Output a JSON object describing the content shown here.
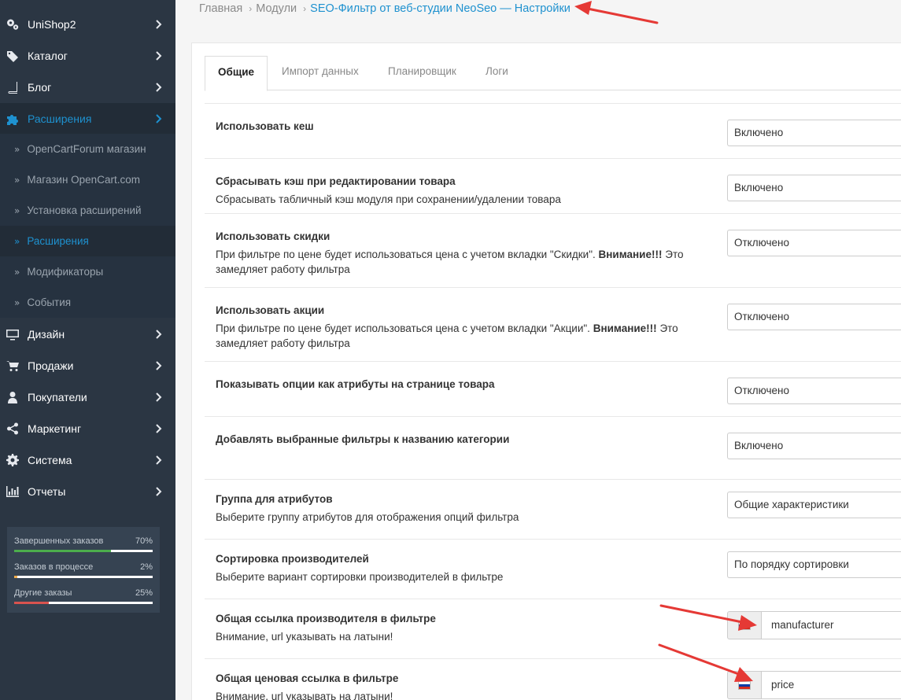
{
  "sidebar": {
    "items": [
      {
        "label": "UniShop2",
        "icon": "gears-icon"
      },
      {
        "label": "Каталог",
        "icon": "tags-icon"
      },
      {
        "label": "Блог",
        "icon": "book-icon"
      },
      {
        "label": "Расширения",
        "icon": "puzzle-icon"
      },
      {
        "label": "Дизайн",
        "icon": "monitor-icon"
      },
      {
        "label": "Продажи",
        "icon": "cart-icon"
      },
      {
        "label": "Покупатели",
        "icon": "user-icon"
      },
      {
        "label": "Маркетинг",
        "icon": "share-icon"
      },
      {
        "label": "Система",
        "icon": "cog-icon"
      },
      {
        "label": "Отчеты",
        "icon": "bar-chart-icon"
      }
    ],
    "subitems": [
      {
        "label": "OpenCartForum магазин"
      },
      {
        "label": "Магазин OpenCart.com"
      },
      {
        "label": "Установка расширений"
      },
      {
        "label": "Расширения"
      },
      {
        "label": "Модификаторы"
      },
      {
        "label": "События"
      }
    ],
    "stats": [
      {
        "label": "Завершенных заказов",
        "percent": "70%",
        "value": 0.7,
        "color": "#4cae4c"
      },
      {
        "label": "Заказов в процессе",
        "percent": "2%",
        "value": 0.02,
        "color": "#f0ad4e"
      },
      {
        "label": "Другие заказы",
        "percent": "25%",
        "value": 0.25,
        "color": "#d9534f"
      }
    ]
  },
  "breadcrumb": {
    "home": "Главная",
    "modules": "Модули",
    "current": "SEO-Фильтр от веб-студии NeoSeo — Настройки"
  },
  "tabs": [
    {
      "label": "Общие"
    },
    {
      "label": "Импорт данных"
    },
    {
      "label": "Планировщик"
    },
    {
      "label": "Логи"
    }
  ],
  "settings": [
    {
      "title": "Использовать кеш",
      "value": "Включено"
    },
    {
      "title": "Сбрасывать кэш при редактировании товара",
      "desc": "Сбрасывать табличный кэш модуля при сохранении/удалении товара",
      "value": "Включено"
    },
    {
      "title": "Использовать скидки",
      "desc_pre": "При фильтре по цене будет использоваться цена с учетом вкладки \"Скидки\".",
      "desc_bold": "Внимание!!!",
      "desc_post": "Это замедляет работу фильтра",
      "value": "Отключено"
    },
    {
      "title": "Использовать акции",
      "desc_pre": "При фильтре по цене будет использоваться цена с учетом вкладки \"Акции\".",
      "desc_bold": "Внимание!!!",
      "desc_post": "Это замедляет работу фильтра",
      "value": "Отключено"
    },
    {
      "title": "Показывать опции как атрибуты на странице товара",
      "value": "Отключено"
    },
    {
      "title": "Добавлять выбранные фильтры к названию категории",
      "value": "Включено"
    },
    {
      "title": "Группа для атрибутов",
      "desc": "Выберите группу атрибутов для отображения опций фильтра",
      "value": "Общие характеристики"
    },
    {
      "title": "Сортировка производителей",
      "desc": "Выберите вариант сортировки производителей в фильтре",
      "value": "По порядку сортировки"
    },
    {
      "title": "Общая ссылка производителя в фильтре",
      "desc": "Внимание, url указывать на латыни!",
      "value": "manufacturer"
    },
    {
      "title": "Общая ценовая ссылка в фильтре",
      "desc": "Внимание, url указывать на латыни!",
      "value": "price"
    }
  ],
  "colors": {
    "sidebar_bg": "#2b3643",
    "accent": "#1e91cf",
    "arrow": "#e53935"
  }
}
